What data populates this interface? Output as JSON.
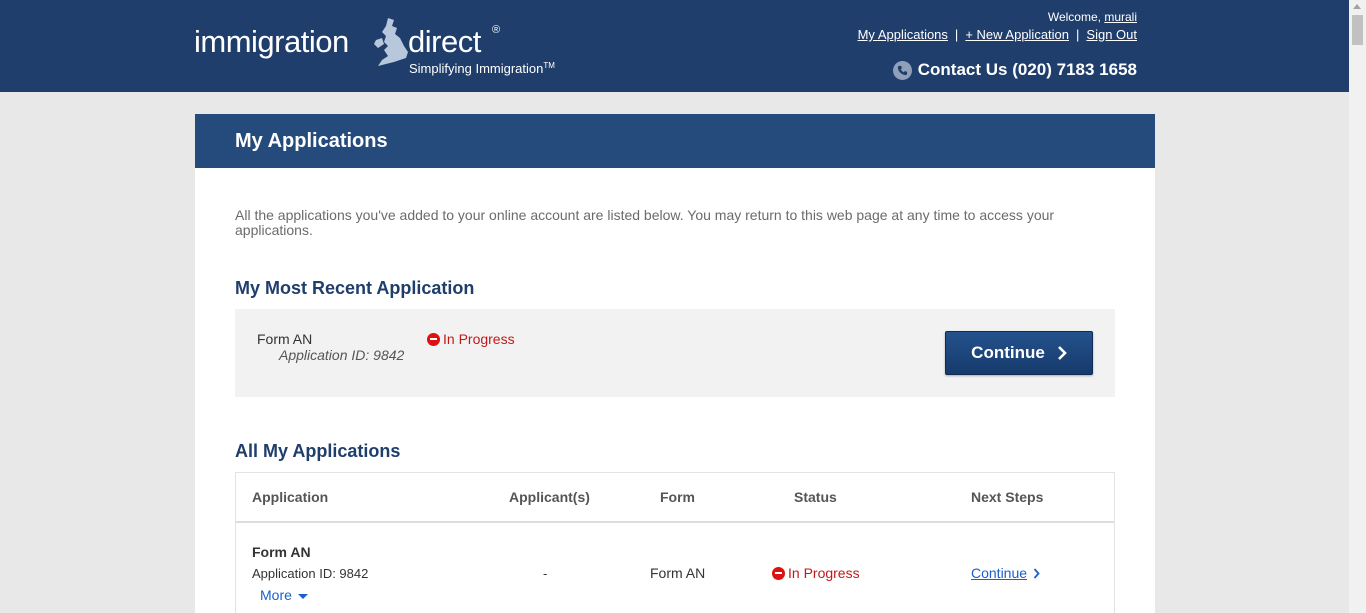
{
  "header": {
    "logo_word1": "immigration",
    "logo_word2": "direct",
    "logo_reg": "®",
    "logo_tagline": "Simplifying Immigration",
    "logo_tm": "TM",
    "welcome_prefix": "Welcome,",
    "username": "murali",
    "nav": [
      "My Applications",
      "+ New Application",
      "Sign Out"
    ],
    "nav_separator": "|",
    "contact_text": "Contact Us (020) 7183 1658"
  },
  "panel": {
    "title": "My Applications",
    "intro": "All the applications you've added to your online account are listed below. You may return to this web page at any time to access your applications."
  },
  "recent": {
    "heading": "My Most Recent Application",
    "form": "Form AN",
    "app_id": "Application ID: 9842",
    "status": "In Progress",
    "continue_label": "Continue"
  },
  "all": {
    "heading": "All My Applications",
    "columns": [
      "Application",
      "Applicant(s)",
      "Form",
      "Status",
      "Next Steps"
    ],
    "rows": [
      {
        "form_title": "Form AN",
        "app_id": "Application ID: 9842",
        "more": "More",
        "applicants": "-",
        "form": "Form AN",
        "status": "In Progress",
        "next_step": "Continue"
      }
    ]
  },
  "colors": {
    "header_bg": "#1f3e6c",
    "panel_head_bg": "#254b7d",
    "status_red": "#c21a1a",
    "link_blue": "#1a5fcc"
  }
}
